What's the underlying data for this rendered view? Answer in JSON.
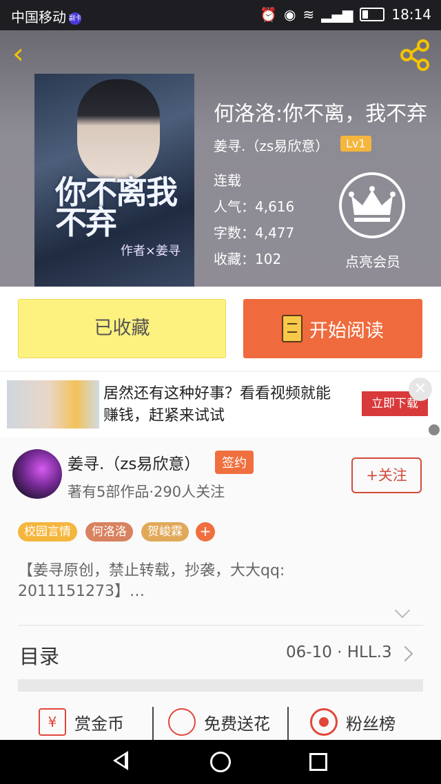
{
  "status_bar": {
    "carrier": "中国移动",
    "carrier_badge": "副卡",
    "time": "18:14"
  },
  "colors": {
    "accent_yellow": "#f5c400",
    "read_button": "#ef6a3c",
    "fav_button": "#fdf17f",
    "tag_campus": "#f5b63d",
    "tag_he": "#d8825f",
    "tag_jun": "#e0a95a",
    "danger": "#d24a3a"
  },
  "header": {
    "back_icon": "chevron-left-icon",
    "share_icon": "share-icon"
  },
  "book": {
    "title": "何洛洛:你不离，我不弃",
    "cover_title": "你不离我不弃",
    "cover_author": "作者×姜寻",
    "author_line": "姜寻.（zs易欣意）",
    "level": "Lv1",
    "status": "连载",
    "popularity": "人气：4,616",
    "word_count": "字数：4,477",
    "favorites": "收藏：102",
    "vip_label": "点亮会员"
  },
  "actions": {
    "fav_label": "已收藏",
    "read_label": "开始阅读"
  },
  "ad": {
    "text": "居然还有这种好事？看看视频就能赚钱，赶紧来试试",
    "button_label": "立即下载",
    "close_icon": "close-icon"
  },
  "author": {
    "name": "姜寻.（zs易欣意）",
    "sign_badge": "签约",
    "stats": "著有5部作品·290人关注",
    "follow_label": "+关注",
    "tags": [
      "校园言情",
      "何洛洛",
      "贺峻霖"
    ],
    "tag_more": "+",
    "description": "【姜寻原创，禁止转载，抄袭，大大qq: 2011151273】…"
  },
  "catalog": {
    "label": "目录",
    "latest": "06-10 · HLL.3"
  },
  "bottom_stats": [
    {
      "label": "赏金币",
      "icon": "reward-coin-icon"
    },
    {
      "label": "免费送花",
      "icon": "flower-icon"
    },
    {
      "label": "粉丝榜",
      "icon": "fan-rank-icon"
    }
  ]
}
